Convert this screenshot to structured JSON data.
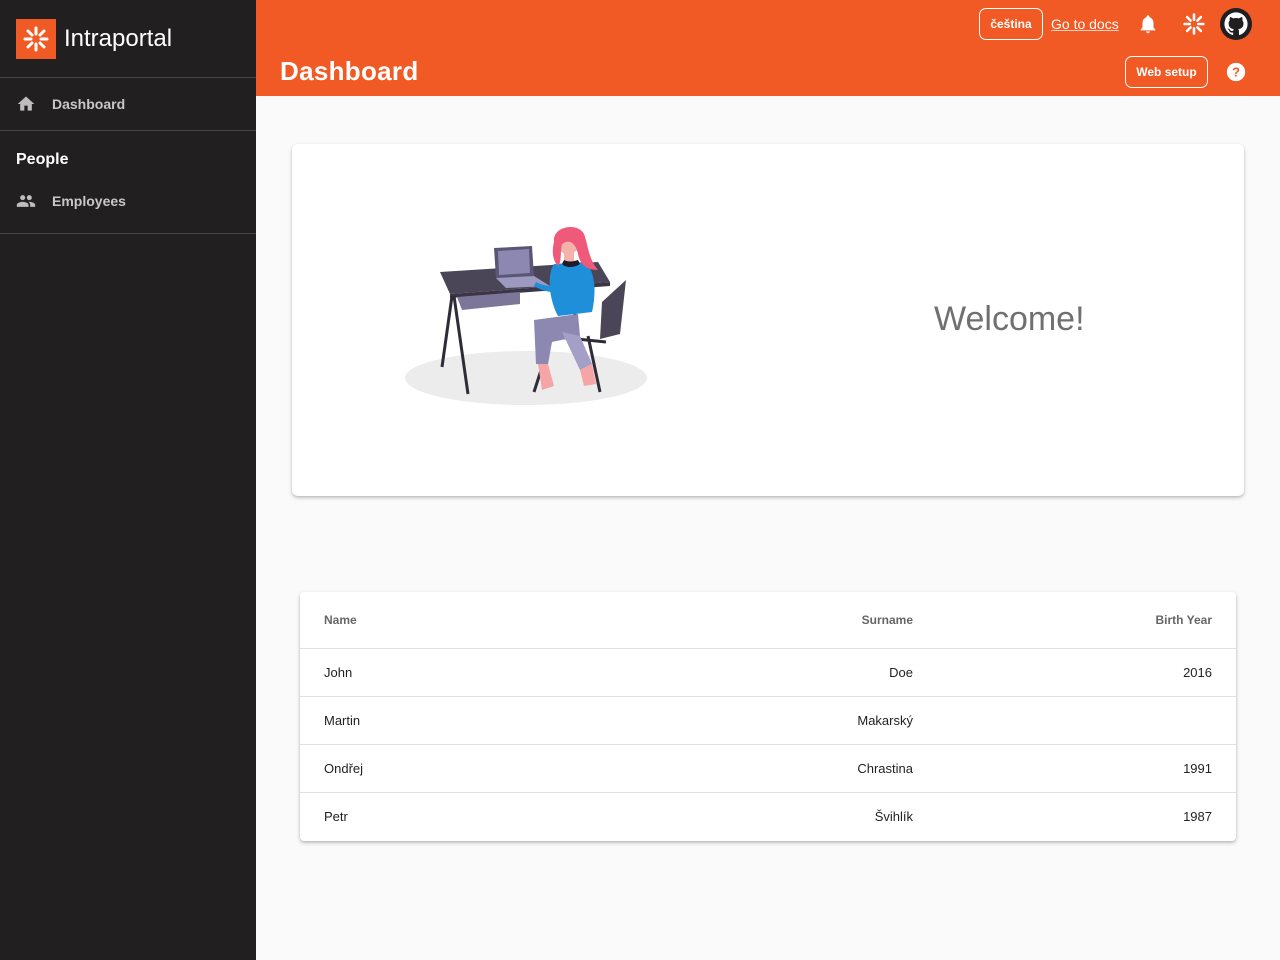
{
  "app": {
    "name": "Intraportal"
  },
  "sidebar": {
    "dashboard_label": "Dashboard",
    "section_people": "People",
    "employees_label": "Employees"
  },
  "header": {
    "title": "Dashboard",
    "lang_label": "čeština",
    "docs_label": "Go to docs",
    "websetup_label": "Web setup"
  },
  "welcome": {
    "text": "Welcome!"
  },
  "table": {
    "columns": [
      "Name",
      "Surname",
      "Birth Year"
    ],
    "rows": [
      {
        "name": "John",
        "surname": "Doe",
        "year": "2016"
      },
      {
        "name": "Martin",
        "surname": "Makarský",
        "year": ""
      },
      {
        "name": "Ondřej",
        "surname": "Chrastina",
        "year": "1991"
      },
      {
        "name": "Petr",
        "surname": "Švihlík",
        "year": "1987"
      }
    ]
  },
  "icons": {
    "home": "home-icon",
    "people": "people-icon",
    "bell": "bell-icon",
    "logo": "asterisk-logo-icon",
    "github": "github-icon",
    "help": "help-icon"
  },
  "colors": {
    "accent": "#f15a24",
    "sidebar": "#221f20"
  }
}
